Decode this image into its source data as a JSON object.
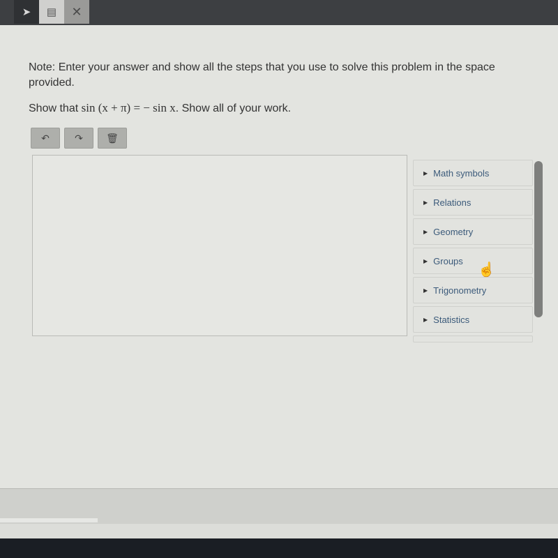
{
  "topbar": {
    "tools": [
      {
        "icon": "pointer-icon",
        "glyph": "➤"
      },
      {
        "icon": "note-icon",
        "glyph": "▤"
      },
      {
        "icon": "close-icon",
        "glyph": "✕"
      }
    ]
  },
  "question": {
    "note": "Note: Enter your answer and show all the steps that you use to solve this problem in the space provided.",
    "prefix": "Show that",
    "math_lhs": "sin (x + π) = − sin x",
    "suffix": ". Show all of your work."
  },
  "editor": {
    "undo_icon": "↶",
    "redo_icon": "↷",
    "delete_icon": "🗑",
    "answer_value": ""
  },
  "palette": {
    "items": [
      {
        "label": "Math symbols"
      },
      {
        "label": "Relations"
      },
      {
        "label": "Geometry"
      },
      {
        "label": "Groups"
      },
      {
        "label": "Trigonometry"
      },
      {
        "label": "Statistics"
      }
    ]
  },
  "cursor": {
    "glyph": "☝"
  }
}
